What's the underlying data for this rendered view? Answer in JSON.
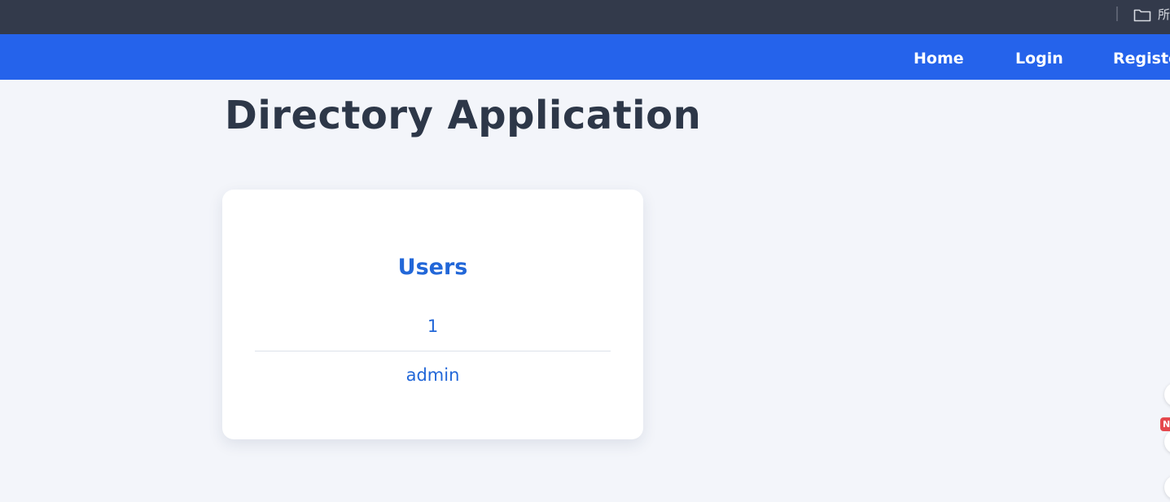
{
  "browser_bar": {
    "folder_label": "所"
  },
  "nav": {
    "items": [
      "Home",
      "Login",
      "Register"
    ]
  },
  "main": {
    "title": "Directory Application",
    "card": {
      "title": "Users",
      "rows": [
        "1",
        "admin"
      ]
    }
  },
  "edge_widgets": {
    "badge": "N"
  },
  "colors": {
    "nav_bg": "#2563eb",
    "top_bar_bg": "#333a4b",
    "page_bg": "#f3f5fa",
    "accent_text": "#2267d8",
    "title_text": "#2d3748"
  }
}
